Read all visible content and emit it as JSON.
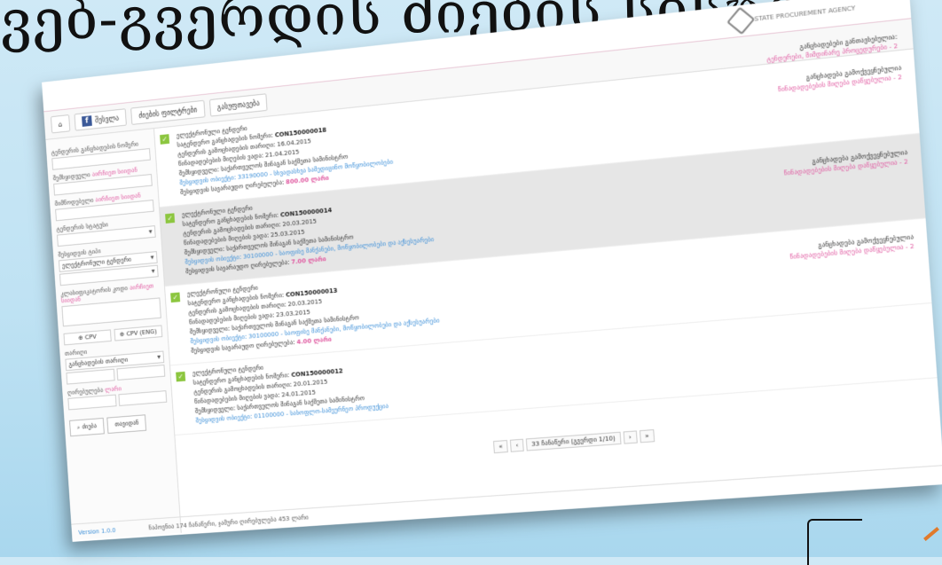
{
  "slide_title": "ვებ-გვერდის ძიების სისტემა",
  "agency": {
    "name": "STATE PROCUREMENT AGENCY",
    "stats_line1": "განცხადებები განთავსებულია:",
    "stats_line2": "ტენდერები, მიმდინარე პროცედურები - 2"
  },
  "toolbar": {
    "home": "⌂",
    "fb": "f",
    "fb_label": "შესვლა",
    "search": "ძიების ფილტრები",
    "reset": "გასუფთავება"
  },
  "sidebar": {
    "f1": "ტენდერის განცხადების ნომერი",
    "f2": "შემსყიდველი",
    "f2_req": "აირჩიეთ სიიდან",
    "f3": "მიმწოდებელი",
    "f3_req": "აირჩიეთ სიიდან",
    "f4": "ტენდერის სტატუსი",
    "f5": "შესყიდვის ტიპი",
    "f5_val": "ელექტრონული ტენდერი",
    "f6": "კლასიფიკატორის კოდი",
    "f6_req": "აირჩიეთ სიიდან",
    "cpv1": "⊕ CPV",
    "cpv2": "⊕ CPV (ENG)",
    "f7": "თარიღი",
    "f7_val": "განცხადების თარიღი",
    "f8": "ღირებულება",
    "f8_req": "ლარი",
    "search_btn": "⌕ ძიება",
    "reset_btn": "თავიდან"
  },
  "records": [
    {
      "title": "ელექტრონული ტენდერი",
      "num_label": "სატენდერო განცხადების ნომერი:",
      "num": "CON150000018",
      "d1": "ტენდერის გამოცხადების თარიღი: 16.04.2015",
      "d2": "წინადადებების მიღების ვადა: 21.04.2015",
      "org": "შემსყიდველი: საქართველოს შინაგან საქმეთა სამინისტრო",
      "class": "შესყიდვის ობიექტი: 33190000 - სხვადასხვა სამედიცინო მოწყობილობები",
      "value_label": "შესყიდვის სავარაუდო ღირებულება:",
      "value": "800.00 ლარი",
      "status1": "განცხადება გამოქვეყნებულია",
      "status2": "წინადადებების მიღება დაწყებულია - 2"
    },
    {
      "title": "ელექტრონული ტენდერი",
      "num_label": "სატენდერო განცხადების ნომერი:",
      "num": "CON150000014",
      "d1": "ტენდერის გამოცხადების თარიღი: 20.03.2015",
      "d2": "წინადადებების მიღების ვადა: 25.03.2015",
      "org": "შემსყიდველი: საქართველოს შინაგან საქმეთა სამინისტრო",
      "class": "შესყიდვის ობიექტი: 30100000 - საოფისე მანქანები, მოწყობილობები და აქსესუარები",
      "value_label": "შესყიდვის სავარაუდო ღირებულება:",
      "value": "7.00 ლარი",
      "status1": "განცხადება გამოქვეყნებულია",
      "status2": "წინადადებების მიღება დაწყებულია - 2"
    },
    {
      "title": "ელექტრონული ტენდერი",
      "num_label": "სატენდერო განცხადების ნომერი:",
      "num": "CON150000013",
      "d1": "ტენდერის გამოცხადების თარიღი: 20.03.2015",
      "d2": "წინადადებების მიღების ვადა: 23.03.2015",
      "org": "შემსყიდველი: საქართველოს შინაგან საქმეთა სამინისტრო",
      "class": "შესყიდვის ობიექტი: 30100000 - საოფისე მანქანები, მოწყობილობები და აქსესუარები",
      "value_label": "შესყიდვის სავარაუდო ღირებულება:",
      "value": "4.00 ლარი",
      "status1": "განცხადება გამოქვეყნებულია",
      "status2": "წინადადებების მიღება დაწყებულია - 2"
    },
    {
      "title": "ელექტრონული ტენდერი",
      "num_label": "სატენდერო განცხადების ნომერი:",
      "num": "CON150000012",
      "d1": "ტენდერის გამოცხადების თარიღი: 20.01.2015",
      "d2": "წინადადებების მიღების ვადა: 24.01.2015",
      "org": "შემსყიდველი: საქართველოს შინაგან საქმეთა სამინისტრო",
      "class": "შესყიდვის ობიექტი: 01100000 - სასოფლო-სამეურნეო პროდუქცია",
      "value_label": "",
      "value": "",
      "status1": "",
      "status2": ""
    }
  ],
  "pager": {
    "first": "«",
    "prev": "‹",
    "info": "33 ჩანაწერი (გვერდი 1/10)",
    "next": "›",
    "last": "»"
  },
  "footer": {
    "left": "Version 1.0.0",
    "center": "ნაპოვნია 174 ჩანაწერი, ჯამური ღირებულება 453 ლარი"
  }
}
